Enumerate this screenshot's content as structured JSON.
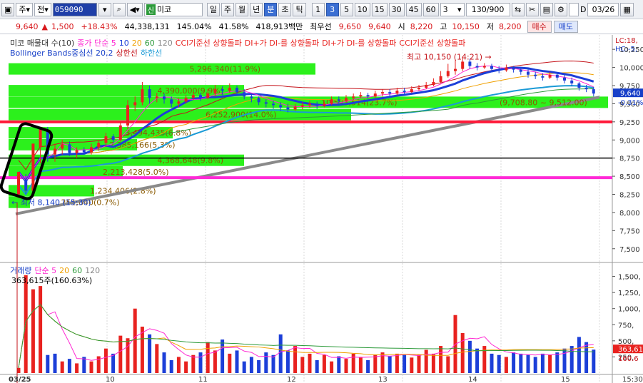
{
  "colors": {
    "up": "#e8221f",
    "down": "#1c3fd8",
    "band_fill": "#2cf01c",
    "ma5": "#ff26d2",
    "ma10": "#1c3fd8",
    "ma20": "#f0a000",
    "ma60": "#2c9a3a",
    "ma120": "#888888"
  },
  "toolbar": {
    "period_label": "주",
    "prev_label": "전",
    "code": "059090",
    "name_badge": "신",
    "name": "미코",
    "intervals": [
      "일",
      "주",
      "월",
      "년",
      "분",
      "초",
      "틱"
    ],
    "active_interval": "분",
    "minutes": [
      "1",
      "3",
      "5",
      "10",
      "15",
      "30",
      "45",
      "60"
    ],
    "active_minute": "3",
    "minute_select": "3",
    "count": "130/900",
    "date": "03/26",
    "d_label": "D"
  },
  "quote": {
    "price": "9,640",
    "change": "1,500",
    "rate": "+18.43%",
    "volume": "44,338,131",
    "vol_ratio": "145.04%",
    "turnover": "41.58%",
    "amount": "418,913백만",
    "best_label": "최우선",
    "ask": "9,650",
    "bid": "9,640",
    "open_label": "시",
    "open": "8,220",
    "high_label": "고",
    "high": "10,150",
    "low_label": "저",
    "low": "8,200",
    "buy_label": "매수",
    "sell_label": "매도"
  },
  "price_panel": {
    "legend1": [
      "미코 매물대 수(10)",
      "종가 단순 5",
      "10",
      "20",
      "60",
      "120",
      "CCI기준선 상향돌파",
      "DI+가 DI-를 상향돌파",
      "DI+가 DI-를 상향돌파",
      "CCI기준선 상향돌파"
    ],
    "legend2": [
      "Bollinger Bands중심선 20,2",
      "상한선",
      "하한선"
    ],
    "side_labels": [
      "LC:18,",
      "HC:-5,"
    ],
    "ticks": [
      "10,250",
      "10,000",
      "9,750",
      "9,500",
      "9,250",
      "9,000",
      "8,750",
      "8,500",
      "8,250",
      "8,000",
      "7,750",
      "7,500"
    ],
    "current_price": "9,640",
    "current_change": "-0.31%",
    "high_note": "최고 10,150 (14:21)",
    "low_note": "최저 8,140 (15:30)",
    "bands": [
      {
        "label": "5,296,340(11.9%)",
        "price": 9980
      },
      {
        "label": "4,390,000(9.9%)",
        "price": 9680
      },
      {
        "label": "10,593,514(23.7%)",
        "price": 9520
      },
      {
        "label": "6,252,900(14.0%)",
        "price": 9350
      },
      {
        "label": "3,494,435(6.8%)",
        "price": 9100
      },
      {
        "label": "2,385,166(5.3%)",
        "price": 8935
      },
      {
        "label": "4,368,648(9.8%)",
        "price": 8720
      },
      {
        "label": "2,213,428(5.0%)",
        "price": 8560
      },
      {
        "label": "1,234,406(2.8%)",
        "price": 8300
      },
      {
        "label": "251,640(0.7%)",
        "price": 8140
      }
    ],
    "band_value_note": "(9,708.80 ~ 9,512.00)"
  },
  "volume_panel": {
    "legend": [
      "거래량",
      "단순 5",
      "20",
      "60",
      "120"
    ],
    "info": "363,615주(160.63%)",
    "ticks": [
      "1,500,",
      "1,250,",
      "1,000,",
      "750,",
      "500,",
      "250,"
    ],
    "current": "363,61",
    "current2": "160.6"
  },
  "x_axis": {
    "labels": [
      "03/25",
      "10",
      "11",
      "12",
      "13",
      "14",
      "15",
      "15:30"
    ]
  },
  "chart_data": {
    "type": "candlestick",
    "series_price": [
      [
        8250,
        8560,
        8200,
        8450
      ],
      [
        8450,
        8300,
        8250,
        8530
      ],
      [
        8300,
        8950,
        8280,
        8900
      ],
      [
        8900,
        9180,
        8680,
        9120
      ],
      [
        9120,
        8800,
        8700,
        9180
      ],
      [
        8800,
        8880,
        8700,
        8950
      ],
      [
        8880,
        8940,
        8800,
        9000
      ],
      [
        8940,
        8820,
        8780,
        8980
      ],
      [
        8820,
        8860,
        8750,
        8900
      ],
      [
        8860,
        8830,
        8800,
        8900
      ],
      [
        8830,
        8900,
        8800,
        8950
      ],
      [
        8900,
        8960,
        8850,
        9000
      ],
      [
        8960,
        9050,
        8900,
        9100
      ],
      [
        9050,
        9000,
        8950,
        9080
      ],
      [
        9000,
        9200,
        8980,
        9250
      ],
      [
        9200,
        9480,
        9150,
        9550
      ],
      [
        9480,
        9520,
        9400,
        9600
      ],
      [
        9520,
        9700,
        9480,
        9800
      ],
      [
        9700,
        9580,
        9500,
        9750
      ],
      [
        9580,
        9600,
        9520,
        9650
      ],
      [
        9600,
        9560,
        9500,
        9640
      ],
      [
        9560,
        9500,
        9450,
        9600
      ],
      [
        9500,
        9530,
        9450,
        9580
      ],
      [
        9530,
        9580,
        9500,
        9620
      ],
      [
        9580,
        9620,
        9550,
        9660
      ],
      [
        9620,
        9580,
        9540,
        9650
      ],
      [
        9580,
        9640,
        9560,
        9700
      ],
      [
        9640,
        9700,
        9600,
        9760
      ],
      [
        9700,
        9680,
        9620,
        9740
      ],
      [
        9680,
        9720,
        9650,
        9780
      ],
      [
        9720,
        9660,
        9620,
        9750
      ],
      [
        9660,
        9600,
        9560,
        9700
      ],
      [
        9600,
        9580,
        9520,
        9640
      ],
      [
        9580,
        9520,
        9480,
        9600
      ],
      [
        9520,
        9500,
        9450,
        9560
      ],
      [
        9500,
        9480,
        9430,
        9540
      ],
      [
        9480,
        9450,
        9400,
        9520
      ],
      [
        9450,
        9420,
        9380,
        9500
      ],
      [
        9420,
        9460,
        9400,
        9500
      ],
      [
        9460,
        9480,
        9420,
        9520
      ],
      [
        9480,
        9500,
        9440,
        9540
      ],
      [
        9500,
        9470,
        9430,
        9530
      ],
      [
        9470,
        9500,
        9450,
        9540
      ],
      [
        9500,
        9560,
        9480,
        9600
      ],
      [
        9560,
        9540,
        9500,
        9600
      ],
      [
        9540,
        9580,
        9520,
        9620
      ],
      [
        9580,
        9600,
        9550,
        9640
      ],
      [
        9600,
        9620,
        9580,
        9660
      ],
      [
        9620,
        9600,
        9570,
        9650
      ],
      [
        9600,
        9640,
        9580,
        9680
      ],
      [
        9640,
        9660,
        9600,
        9700
      ],
      [
        9660,
        9640,
        9600,
        9700
      ],
      [
        9640,
        9680,
        9620,
        9720
      ],
      [
        9680,
        9660,
        9630,
        9720
      ],
      [
        9660,
        9700,
        9650,
        9740
      ],
      [
        9700,
        9720,
        9680,
        9760
      ],
      [
        9720,
        9760,
        9700,
        9800
      ],
      [
        9760,
        9800,
        9740,
        9850
      ],
      [
        9800,
        9880,
        9780,
        9950
      ],
      [
        9880,
        9950,
        9860,
        10050
      ],
      [
        9950,
        9980,
        9900,
        10100
      ],
      [
        9980,
        10080,
        9950,
        10150
      ],
      [
        10080,
        10020,
        9980,
        10120
      ],
      [
        10020,
        10000,
        9960,
        10060
      ],
      [
        10000,
        10020,
        9980,
        10060
      ],
      [
        10020,
        9980,
        9940,
        10050
      ],
      [
        9980,
        9960,
        9920,
        10020
      ],
      [
        9960,
        10000,
        9940,
        10040
      ],
      [
        10000,
        9970,
        9930,
        10020
      ],
      [
        9970,
        9940,
        9900,
        10000
      ],
      [
        9940,
        9900,
        9860,
        9980
      ],
      [
        9900,
        9880,
        9840,
        9940
      ],
      [
        9880,
        9860,
        9820,
        9920
      ],
      [
        9860,
        9900,
        9840,
        9940
      ],
      [
        9900,
        9860,
        9820,
        9920
      ],
      [
        9860,
        9820,
        9780,
        9900
      ],
      [
        9820,
        9780,
        9740,
        9860
      ],
      [
        9780,
        9720,
        9680,
        9800
      ],
      [
        9720,
        9700,
        9660,
        9760
      ],
      [
        9700,
        9640,
        9600,
        9730
      ]
    ],
    "series_volume": [
      80,
      1520,
      1300,
      1350,
      280,
      300,
      180,
      220,
      150,
      250,
      180,
      260,
      380,
      300,
      580,
      540,
      1000,
      720,
      600,
      450,
      320,
      200,
      250,
      180,
      280,
      320,
      480,
      350,
      520,
      300,
      350,
      180,
      250,
      200,
      320,
      280,
      600,
      350,
      420,
      250,
      300,
      200,
      280,
      180,
      260,
      220,
      300,
      250,
      200,
      280,
      320,
      260,
      300,
      280,
      240,
      280,
      360,
      300,
      420,
      260,
      900,
      620,
      500,
      380,
      420,
      300,
      280,
      250,
      320,
      300,
      280,
      250,
      300,
      280,
      320,
      380,
      420,
      560,
      480,
      363
    ],
    "up_down": [
      1,
      1,
      1,
      1,
      0,
      0,
      1,
      0,
      1,
      0,
      1,
      1,
      1,
      0,
      1,
      1,
      1,
      1,
      0,
      1,
      0,
      0,
      1,
      1,
      1,
      0,
      1,
      1,
      0,
      1,
      0,
      0,
      0,
      0,
      0,
      0,
      0,
      0,
      1,
      1,
      1,
      0,
      1,
      1,
      0,
      1,
      1,
      1,
      0,
      1,
      1,
      0,
      1,
      0,
      1,
      1,
      1,
      1,
      1,
      1,
      1,
      1,
      0,
      0,
      1,
      0,
      0,
      1,
      0,
      0,
      0,
      0,
      0,
      1,
      0,
      0,
      0,
      0,
      0,
      0
    ],
    "ma120_range": [
      7980,
      9590
    ],
    "ylim_price": [
      7350,
      10350
    ],
    "ylim_volume": [
      0,
      1650
    ]
  }
}
